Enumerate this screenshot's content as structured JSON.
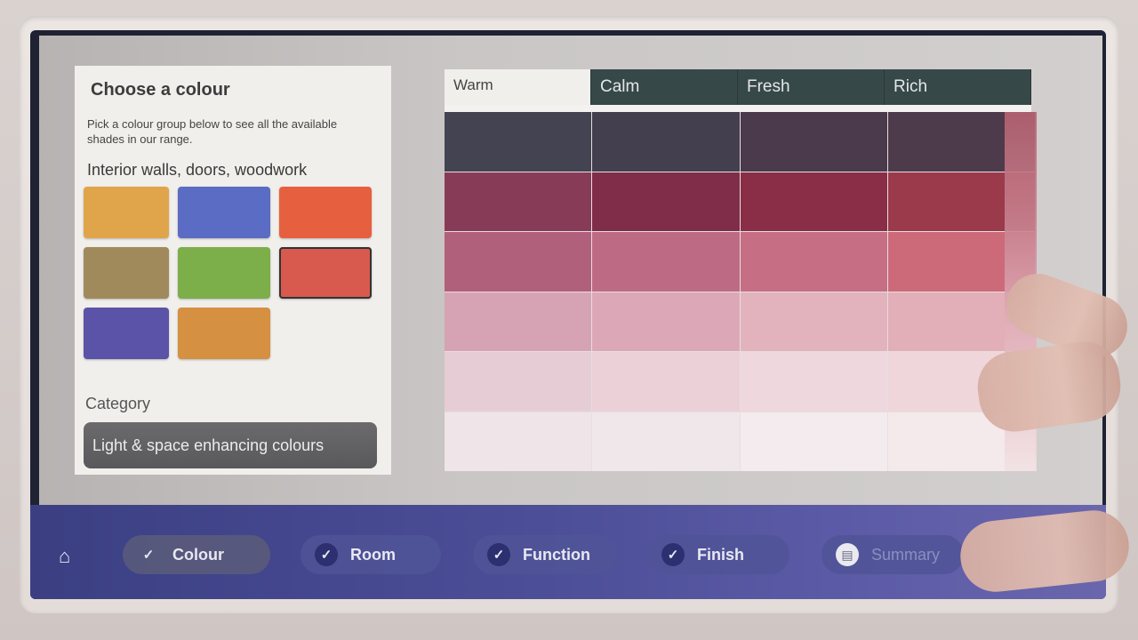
{
  "left_panel": {
    "title": "Choose a colour",
    "description": "Pick a colour group below to see all the available shades in our range.",
    "section_heading": "Interior walls, doors, woodwork",
    "swatches": [
      {
        "color": "#e0a54a",
        "selected": false
      },
      {
        "color": "#5b6cc4",
        "selected": false
      },
      {
        "color": "#e6603f",
        "selected": false
      },
      {
        "color": "#a08a5c",
        "selected": false
      },
      {
        "color": "#7cae4a",
        "selected": false
      },
      {
        "color": "#d85a4f",
        "selected": true
      },
      {
        "color": "#5b53a8",
        "selected": false
      },
      {
        "color": "#d59042",
        "selected": false
      }
    ],
    "category_label": "Category",
    "category_value": "Light & space enhancing colours"
  },
  "tabs": [
    "Warm",
    "Calm",
    "Fresh",
    "Rich"
  ],
  "active_tab": "Warm",
  "shade_colors": [
    [
      "#444351",
      "#433f4f",
      "#4b3a4b",
      "#4d3b4b"
    ],
    [
      "#883b57",
      "#7f2d48",
      "#8a2e47",
      "#9a3a4b"
    ],
    [
      "#b1607b",
      "#bd6b84",
      "#c66e84",
      "#cc6a7a"
    ],
    [
      "#d6a3b5",
      "#dca8b8",
      "#e2b2bd",
      "#e2aeb7"
    ],
    [
      "#e6cdd5",
      "#ebd0d8",
      "#efd8dd",
      "#efd6da"
    ],
    [
      "#efe4e7",
      "#f0e7ea",
      "#f3ebed",
      "#f4e9eb"
    ]
  ],
  "nav": {
    "home_icon": "home-icon",
    "steps": [
      {
        "label": "Colour",
        "state": "current"
      },
      {
        "label": "Room",
        "state": "done"
      },
      {
        "label": "Function",
        "state": "done"
      },
      {
        "label": "Finish",
        "state": "done"
      },
      {
        "label": "Summary",
        "state": "pending"
      }
    ]
  }
}
